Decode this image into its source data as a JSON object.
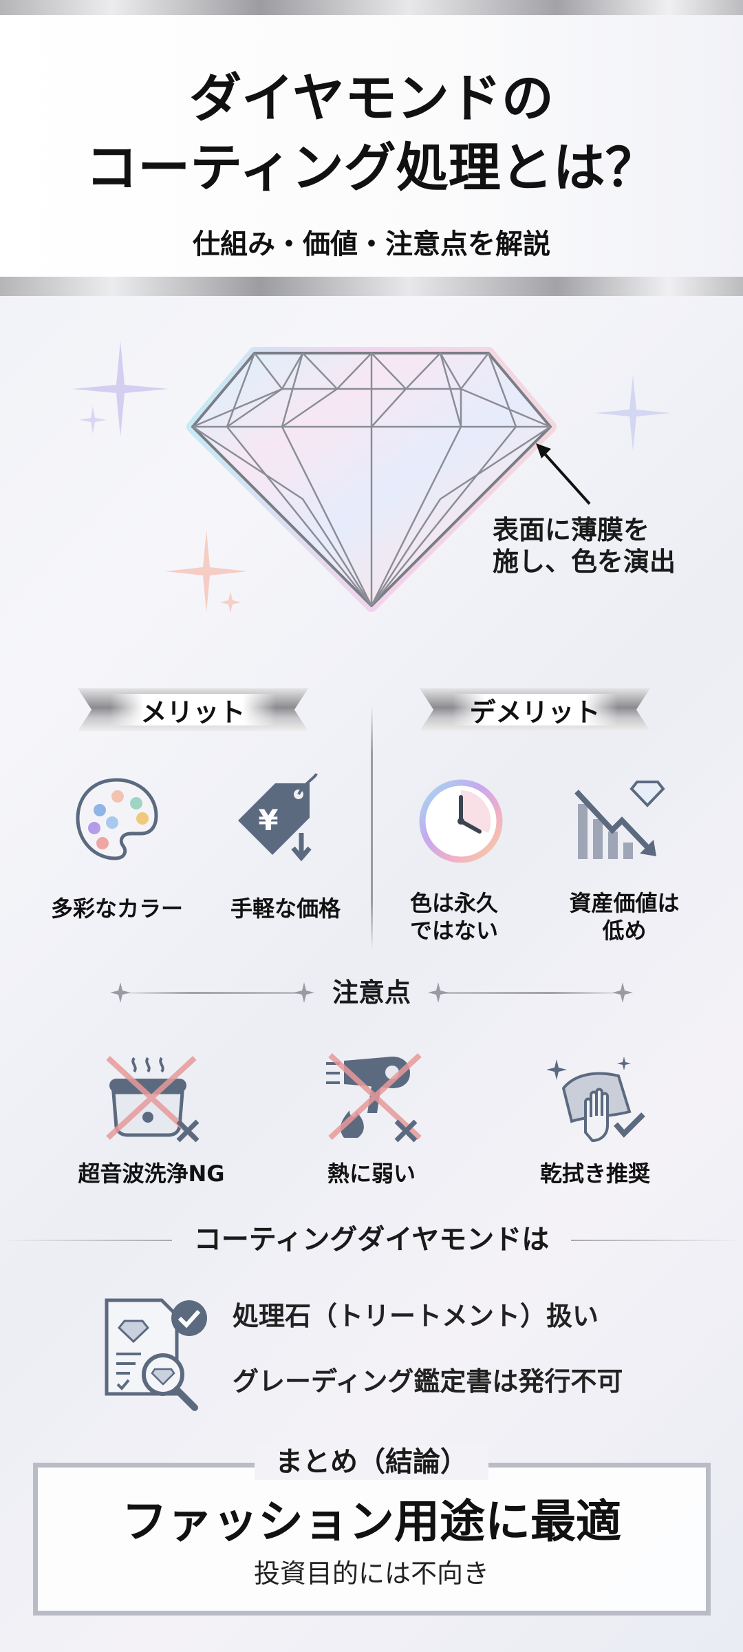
{
  "header": {
    "title_line1": "ダイヤモンドの",
    "title_line2": "コーティング処理とは？",
    "subtitle": "仕組み・価値・注意点を解説"
  },
  "diamond": {
    "annotation_line1": "表面に薄膜を",
    "annotation_line2": "施し、色を演出"
  },
  "merits": {
    "heading": "メリット",
    "items": [
      {
        "label": "多彩なカラー",
        "icon": "palette-icon"
      },
      {
        "label": "手軽な価格",
        "icon": "price-tag-yen-icon",
        "symbol": "¥"
      }
    ]
  },
  "demerits": {
    "heading": "デメリット",
    "items": [
      {
        "label_line1": "色は永久",
        "label_line2": "ではない",
        "icon": "clock-icon"
      },
      {
        "label_line1": "資産価値は",
        "label_line2": "低め",
        "icon": "declining-chart-icon"
      }
    ]
  },
  "cautions": {
    "heading": "注意点",
    "items": [
      {
        "label": "超音波洗浄NG",
        "icon": "ultrasonic-cleaner-icon"
      },
      {
        "label": "熱に弱い",
        "icon": "hair-dryer-heat-icon"
      },
      {
        "label": "乾拭き推奨",
        "icon": "dry-wipe-cloth-icon"
      }
    ]
  },
  "coated": {
    "heading": "コーティングダイヤモンドは",
    "items": [
      {
        "text": "処理石（トリートメント）扱い"
      },
      {
        "text": "グレーディング鑑定書は発行不可"
      }
    ]
  },
  "summary": {
    "heading": "まとめ（結論）",
    "main": "ファッション用途に最適",
    "sub": "投資目的には不向き"
  },
  "colors": {
    "icon_slate": "#5c6a80",
    "cross_red": "#e79a9a",
    "accent_silver": "#b9bcc6"
  }
}
